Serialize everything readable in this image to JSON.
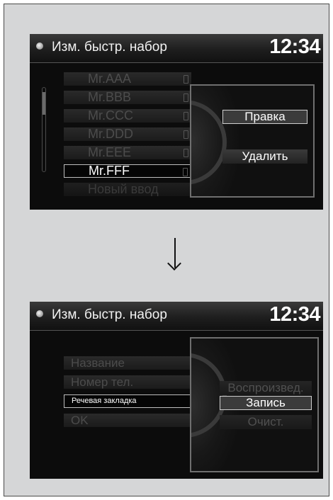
{
  "screen1": {
    "title": "Изм. быстр. набор",
    "clock": "12:34",
    "list": [
      {
        "label": "Mr.AAA",
        "state": "normal"
      },
      {
        "label": "Mr.BBB",
        "state": "normal"
      },
      {
        "label": "Mr.CCC",
        "state": "normal"
      },
      {
        "label": "Mr.DDD",
        "state": "normal"
      },
      {
        "label": "Mr.EEE",
        "state": "normal"
      },
      {
        "label": "Mr.FFF",
        "state": "selected"
      },
      {
        "label": "Новый ввод",
        "state": "dim"
      }
    ],
    "popup": {
      "edit": "Правка",
      "delete": "Удалить"
    }
  },
  "screen2": {
    "title": "Изм. быстр. набор",
    "clock": "12:34",
    "form": [
      {
        "label": "Название",
        "state": "normal"
      },
      {
        "label": "Номер тел.",
        "state": "normal"
      },
      {
        "label": "Речевая закладка",
        "state": "selected"
      },
      {
        "label": "OK",
        "state": "normal"
      }
    ],
    "popup": {
      "play": "Воспроизвед.",
      "record": "Запись",
      "clear": "Очист."
    }
  },
  "icons": {
    "title_icon": "disc-icon",
    "phone_icon": "phone-icon",
    "arrow": "arrow-down-icon"
  }
}
